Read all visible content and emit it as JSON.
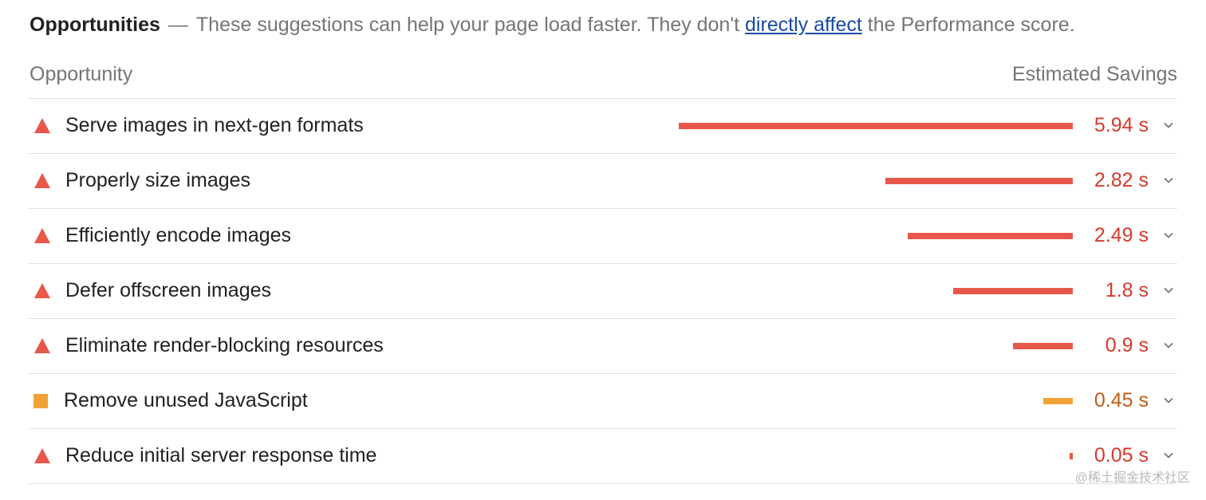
{
  "header": {
    "title": "Opportunities",
    "dash": "—",
    "desc_before": "These suggestions can help your page load faster. They don't",
    "link": "directly affect",
    "desc_after": "the Performance score."
  },
  "columns": {
    "left": "Opportunity",
    "right": "Estimated Savings"
  },
  "max_savings_seconds": 5.94,
  "rows": [
    {
      "label": "Serve images in next-gen formats",
      "value": "5.94 s",
      "seconds": 5.94,
      "severity": "fail",
      "icon": "triangle-warning-icon"
    },
    {
      "label": "Properly size images",
      "value": "2.82 s",
      "seconds": 2.82,
      "severity": "fail",
      "icon": "triangle-warning-icon"
    },
    {
      "label": "Efficiently encode images",
      "value": "2.49 s",
      "seconds": 2.49,
      "severity": "fail",
      "icon": "triangle-warning-icon"
    },
    {
      "label": "Defer offscreen images",
      "value": "1.8 s",
      "seconds": 1.8,
      "severity": "fail",
      "icon": "triangle-warning-icon"
    },
    {
      "label": "Eliminate render-blocking resources",
      "value": "0.9 s",
      "seconds": 0.9,
      "severity": "fail",
      "icon": "triangle-warning-icon"
    },
    {
      "label": "Remove unused JavaScript",
      "value": "0.45 s",
      "seconds": 0.45,
      "severity": "average",
      "icon": "orange-square-icon"
    },
    {
      "label": "Reduce initial server response time",
      "value": "0.05 s",
      "seconds": 0.05,
      "severity": "fail",
      "icon": "triangle-warning-icon"
    }
  ],
  "colors": {
    "fail": "#e8584a",
    "fail_text": "#d33a2c",
    "average": "#f0a237",
    "average_text": "#c05a14",
    "link": "#1a49a8"
  },
  "watermark": "@稀土掘金技术社区"
}
